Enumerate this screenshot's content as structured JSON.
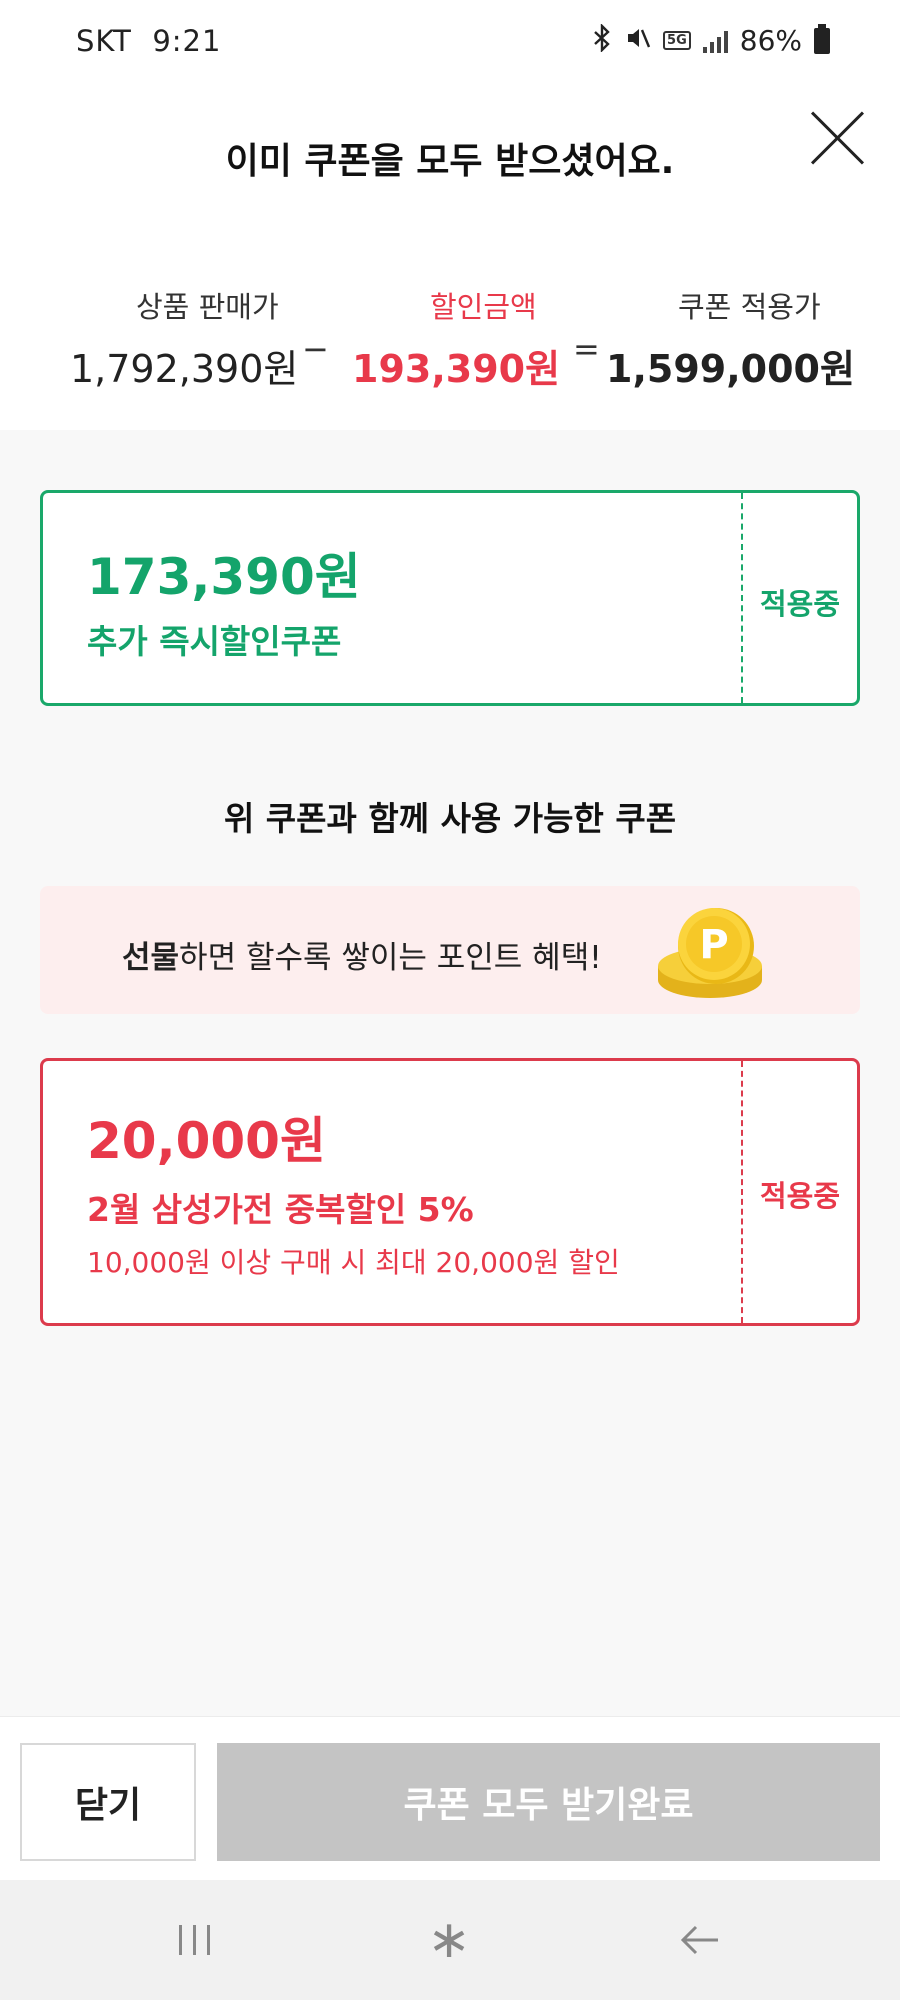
{
  "status_bar": {
    "carrier": "SKT",
    "time": "9:21",
    "network": "5G",
    "battery": "86%"
  },
  "header": {
    "title": "이미 쿠폰을 모두 받으셨어요."
  },
  "summary": {
    "product_price_label": "상품 판매가",
    "product_price": "1,792,390원",
    "minus": "−",
    "discount_label": "할인금액",
    "discount_amount": "193,390원",
    "equals": "=",
    "final_price_label": "쿠폰 적용가",
    "final_price": "1,599,000원"
  },
  "coupons": [
    {
      "amount": "173,390원",
      "name": "추가 즉시할인쿠폰",
      "status": "적용중",
      "color": "#14a46b"
    },
    {
      "amount": "20,000원",
      "name": "2월 삼성가전 중복할인 5%",
      "description": "10,000원 이상 구매 시 최대 20,000원 할인",
      "status": "적용중",
      "color": "#e8394a"
    }
  ],
  "section_title": "위 쿠폰과 함께 사용 가능한 쿠폰",
  "banner": {
    "bold_text": "선물",
    "text": "하면 할수록 쌓이는 포인트 혜택!",
    "coin_letter": "P",
    "icon": "point-coin-icon"
  },
  "bottom": {
    "close_label": "닫기",
    "done_label": "쿠폰 모두 받기완료"
  },
  "nav": {
    "recent_icon": "recent-apps-icon",
    "home_icon": "home-icon",
    "home_glyph": "∗",
    "back_icon": "back-icon"
  },
  "colors": {
    "green": "#14a46b",
    "red": "#e8394a",
    "disabled": "#c4c4c4"
  }
}
